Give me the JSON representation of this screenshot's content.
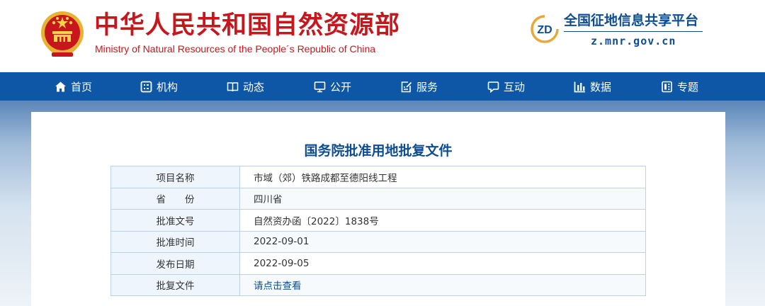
{
  "header": {
    "title_cn": "中华人民共和国自然资源部",
    "title_en": "Ministry of Natural Resources of the People´s Republic of China",
    "platform_logo_text": "ZD",
    "platform_title": "全国征地信息共享平台",
    "platform_url": "z.mnr.gov.cn"
  },
  "nav": {
    "items": [
      {
        "label": "首页",
        "icon": "home-icon"
      },
      {
        "label": "机构",
        "icon": "org-icon"
      },
      {
        "label": "动态",
        "icon": "book-icon"
      },
      {
        "label": "公开",
        "icon": "monitor-icon"
      },
      {
        "label": "服务",
        "icon": "edit-doc-icon"
      },
      {
        "label": "互动",
        "icon": "chat-icon"
      },
      {
        "label": "数据",
        "icon": "bar-chart-icon"
      },
      {
        "label": "专题",
        "icon": "topic-icon"
      }
    ]
  },
  "document": {
    "title": "国务院批准用地批复文件",
    "rows": [
      {
        "label": "项目名称",
        "value": "市域（郊）铁路成都至德阳线工程"
      },
      {
        "label": "省　　份",
        "value": "四川省"
      },
      {
        "label": "批准文号",
        "value": "自然资办函〔2022〕1838号"
      },
      {
        "label": "批准时间",
        "value": "2022-09-01"
      },
      {
        "label": "发布日期",
        "value": "2022-09-05"
      },
      {
        "label": "批复文件",
        "value": "请点击查看"
      }
    ]
  },
  "colors": {
    "brand_red": "#c8161d",
    "brand_blue": "#0e4d92",
    "nav_blue": "#0e56a6",
    "table_border": "#b9d3ea"
  }
}
